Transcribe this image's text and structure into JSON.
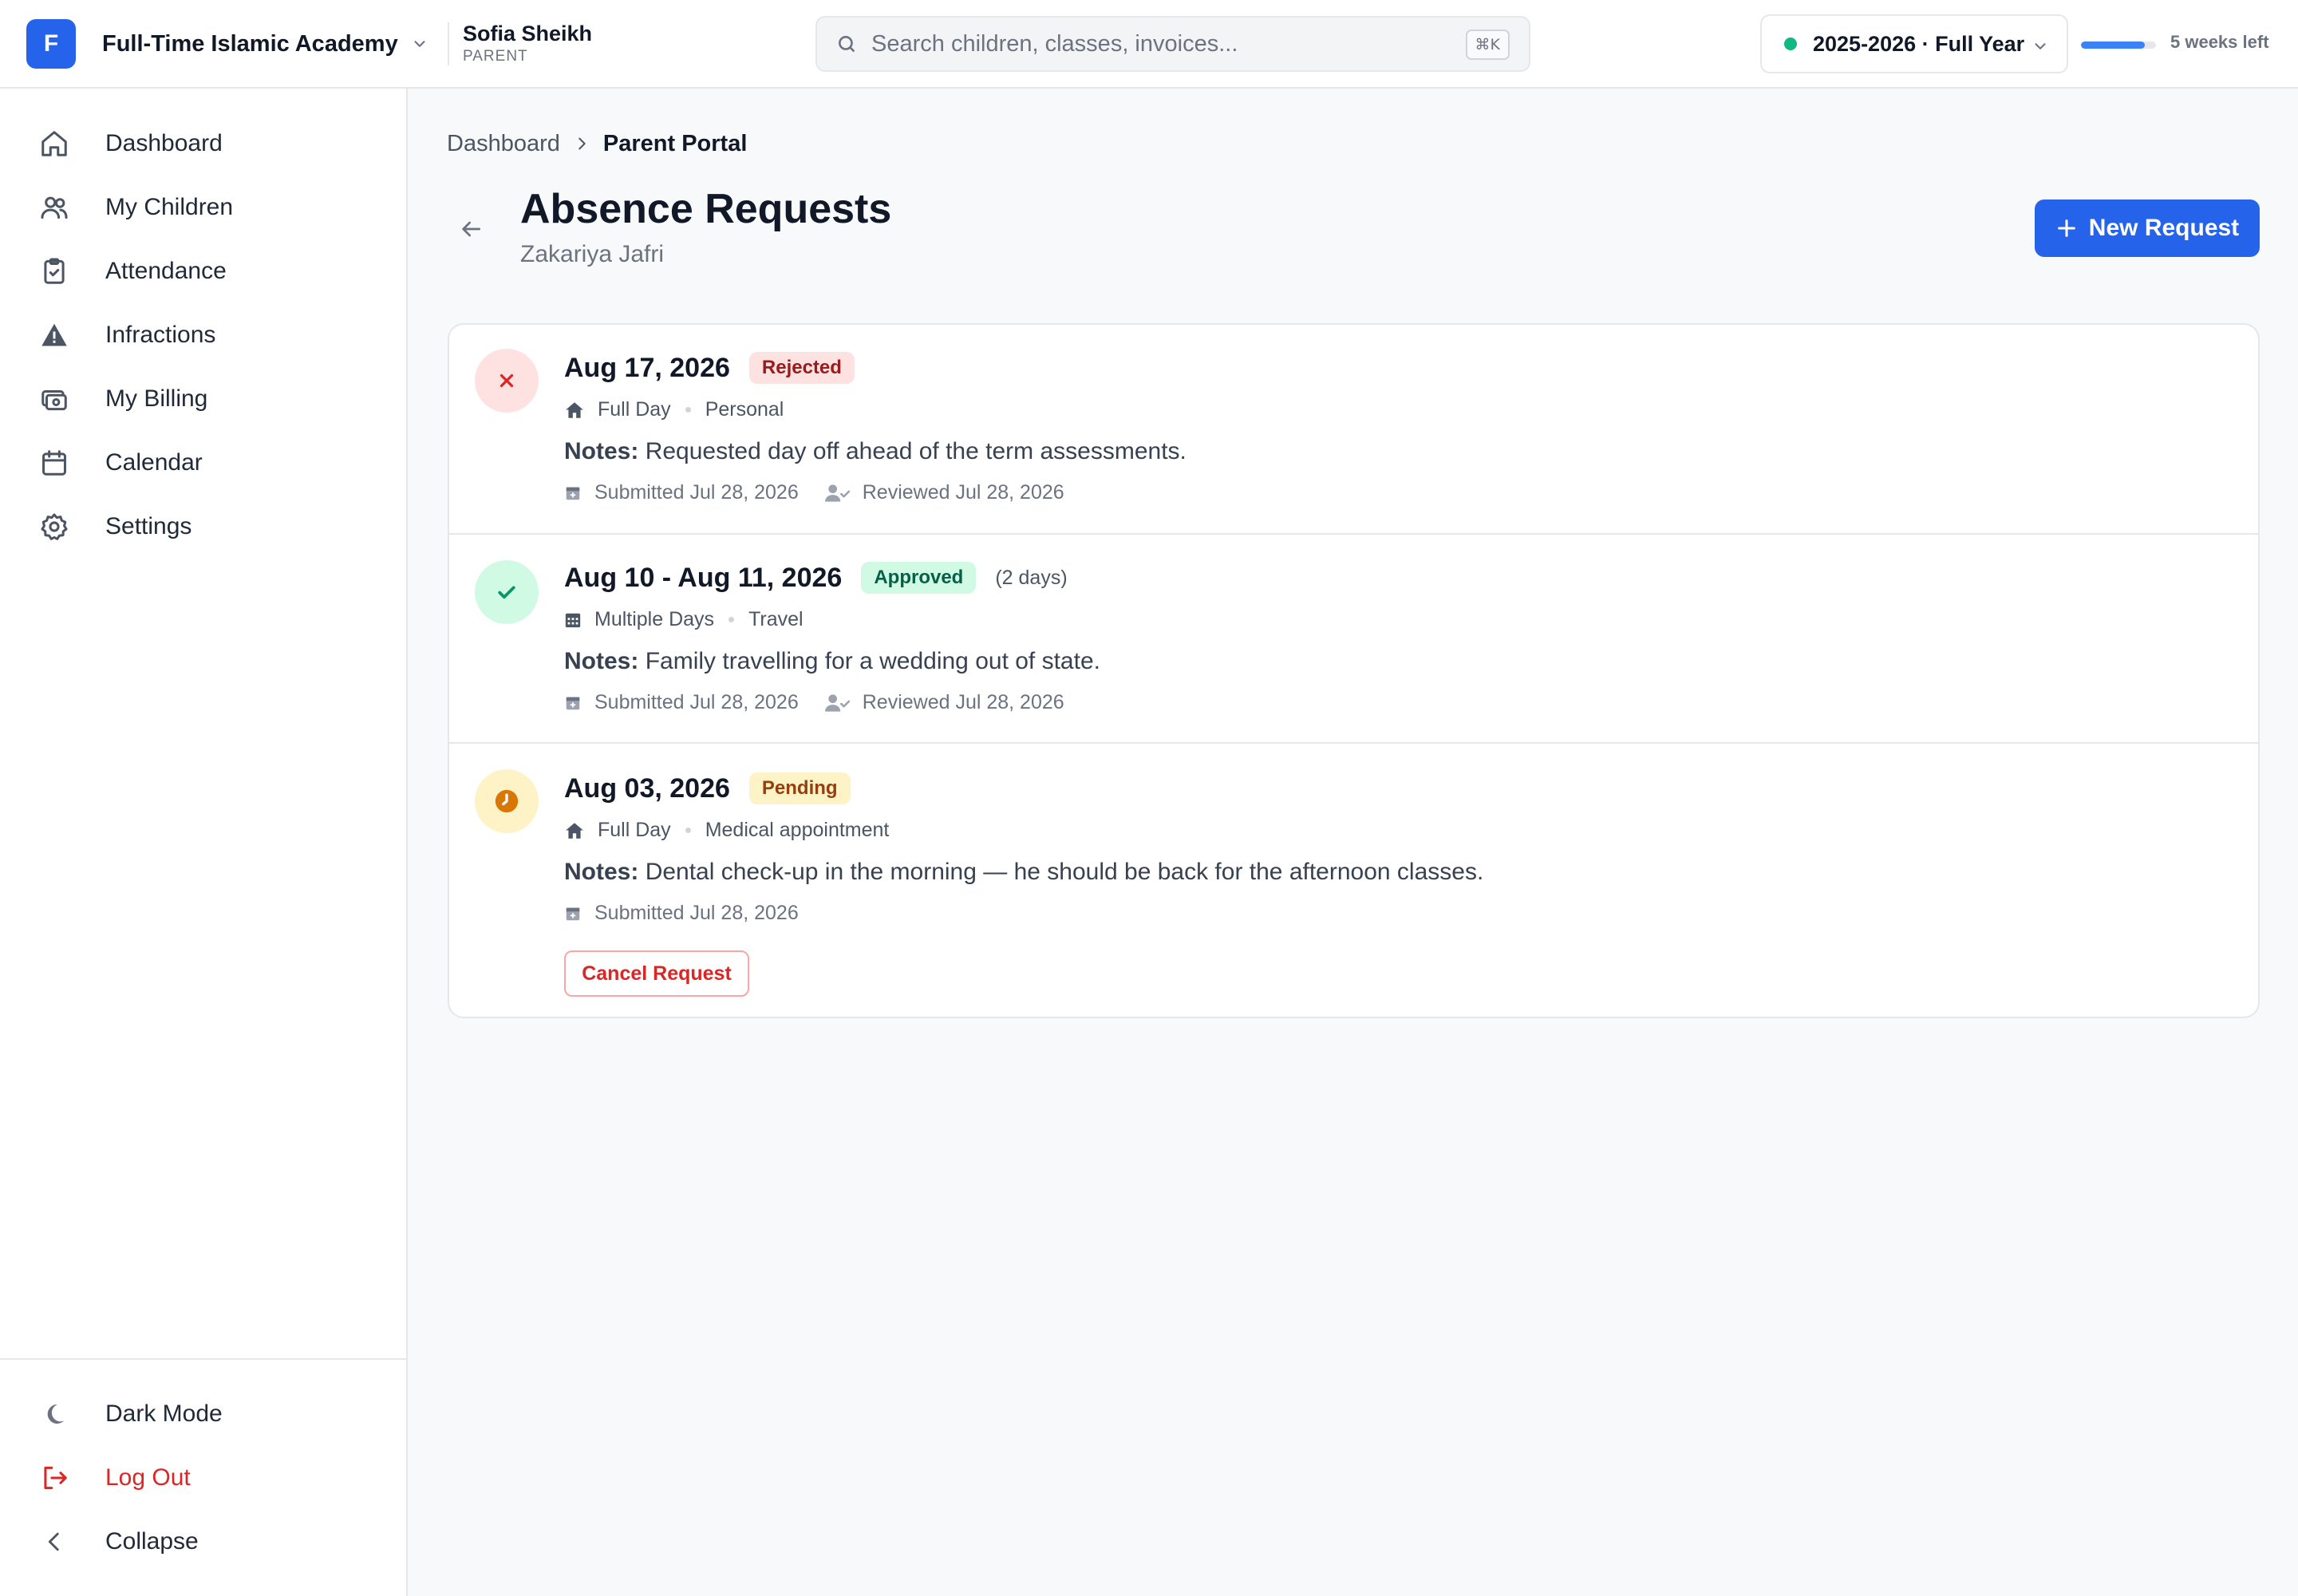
{
  "org": {
    "initial": "F",
    "name": "Full-Time Islamic Academy"
  },
  "user": {
    "name": "Sofia Sheikh",
    "role": "PARENT"
  },
  "search": {
    "placeholder": "Search children, classes, invoices...",
    "shortcut": "⌘K"
  },
  "term": {
    "label": "2025-2026 · Full Year",
    "status_color": "#10b981",
    "progress": 0.85,
    "remaining": "5 weeks left"
  },
  "sidebar": {
    "items": [
      {
        "label": "Dashboard",
        "icon": "home-icon"
      },
      {
        "label": "My Children",
        "icon": "users-icon"
      },
      {
        "label": "Attendance",
        "icon": "clipboard-check-icon"
      },
      {
        "label": "Infractions",
        "icon": "warning-icon"
      },
      {
        "label": "My Billing",
        "icon": "billing-icon"
      },
      {
        "label": "Calendar",
        "icon": "calendar-icon"
      },
      {
        "label": "Settings",
        "icon": "gear-icon"
      }
    ],
    "bottom": {
      "dark_mode": "Dark Mode",
      "logout": "Log Out",
      "collapse": "Collapse"
    }
  },
  "breadcrumb": {
    "parent": "Dashboard",
    "current": "Parent Portal"
  },
  "page": {
    "title": "Absence Requests",
    "subtitle": "Zakariya Jafri",
    "new_button": "New Request"
  },
  "requests": [
    {
      "date": "Aug 17, 2026",
      "status": "Rejected",
      "type": "Full Day",
      "reason": "Personal",
      "notes_label": "Notes:",
      "notes": "Requested day off ahead of the term assessments.",
      "submitted": "Submitted Jul 28, 2026",
      "reviewed": "Reviewed Jul 28, 2026"
    },
    {
      "date": "Aug 10 - Aug 11, 2026",
      "status": "Approved",
      "duration": "(2 days)",
      "type": "Multiple Days",
      "reason": "Travel",
      "notes_label": "Notes:",
      "notes": "Family travelling for a wedding out of state.",
      "submitted": "Submitted Jul 28, 2026",
      "reviewed": "Reviewed Jul 28, 2026"
    },
    {
      "date": "Aug 03, 2026",
      "status": "Pending",
      "type": "Full Day",
      "reason": "Medical appointment",
      "notes_label": "Notes:",
      "notes": "Dental check-up in the morning — he should be back for the afternoon classes.",
      "submitted": "Submitted Jul 28, 2026",
      "cancel_button": "Cancel Request"
    }
  ],
  "colors": {
    "primary": "#2563eb",
    "rejected": "#dc2626",
    "approved": "#059669",
    "pending": "#d97706"
  }
}
